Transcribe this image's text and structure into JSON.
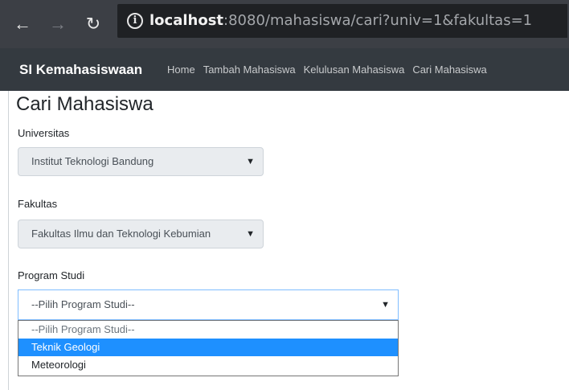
{
  "browser": {
    "url_host": "localhost",
    "url_rest": ":8080/mahasiswa/cari?univ=1&fakultas=1",
    "icons": {
      "back": "arrow-left",
      "forward": "arrow-right",
      "reload": "reload",
      "info": "info-circle"
    }
  },
  "navbar": {
    "brand": "SI Kemahasiswaan",
    "links": [
      "Home",
      "Tambah Mahasiswa",
      "Kelulusan Mahasiswa",
      "Cari Mahasiswa"
    ]
  },
  "page": {
    "title": "Cari Mahasiswa",
    "universitas": {
      "label": "Universitas",
      "value": "Institut Teknologi Bandung"
    },
    "fakultas": {
      "label": "Fakultas",
      "value": "Fakultas Ilmu dan Teknologi Kebumian"
    },
    "prodi": {
      "label": "Program Studi",
      "value": "--Pilih Program Studi--",
      "options": [
        "--Pilih Program Studi--",
        "Teknik Geologi",
        "Meteorologi"
      ],
      "highlighted_index": 1
    }
  },
  "colors": {
    "navbar_bg": "#343a40",
    "chrome_bg": "#3c3f45",
    "highlight": "#1e90ff"
  }
}
